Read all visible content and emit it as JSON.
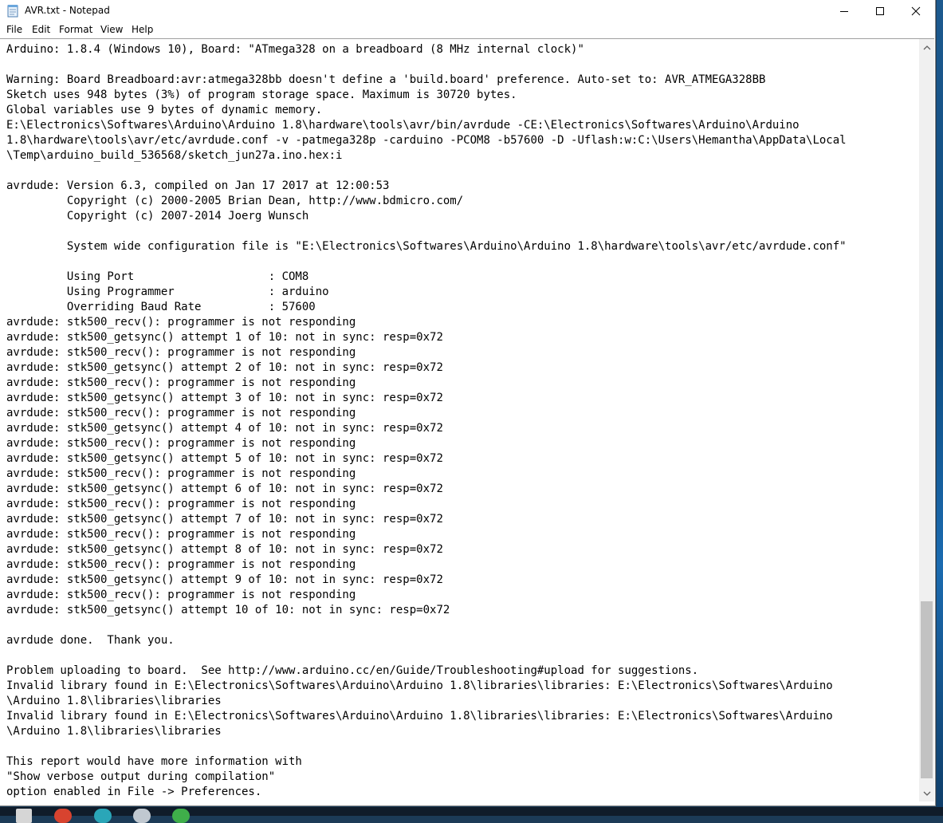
{
  "window": {
    "title": "AVR.txt - Notepad",
    "app_icon": "notepad-icon",
    "controls": {
      "minimize": "minimize-icon",
      "maximize": "maximize-icon",
      "close": "close-icon"
    }
  },
  "menu": {
    "items": [
      {
        "label": "File"
      },
      {
        "label": "Edit"
      },
      {
        "label": "Format"
      },
      {
        "label": "View"
      },
      {
        "label": "Help"
      }
    ]
  },
  "editor": {
    "text": "Arduino: 1.8.4 (Windows 10), Board: \"ATmega328 on a breadboard (8 MHz internal clock)\"\n\nWarning: Board Breadboard:avr:atmega328bb doesn't define a 'build.board' preference. Auto-set to: AVR_ATMEGA328BB\nSketch uses 948 bytes (3%) of program storage space. Maximum is 30720 bytes.\nGlobal variables use 9 bytes of dynamic memory.\nE:\\Electronics\\Softwares\\Arduino\\Arduino 1.8\\hardware\\tools\\avr/bin/avrdude -CE:\\Electronics\\Softwares\\Arduino\\Arduino\n1.8\\hardware\\tools\\avr/etc/avrdude.conf -v -patmega328p -carduino -PCOM8 -b57600 -D -Uflash:w:C:\\Users\\Hemantha\\AppData\\Local\n\\Temp\\arduino_build_536568/sketch_jun27a.ino.hex:i\n\navrdude: Version 6.3, compiled on Jan 17 2017 at 12:00:53\n         Copyright (c) 2000-2005 Brian Dean, http://www.bdmicro.com/\n         Copyright (c) 2007-2014 Joerg Wunsch\n\n         System wide configuration file is \"E:\\Electronics\\Softwares\\Arduino\\Arduino 1.8\\hardware\\tools\\avr/etc/avrdude.conf\"\n\n         Using Port                    : COM8\n         Using Programmer              : arduino\n         Overriding Baud Rate          : 57600\navrdude: stk500_recv(): programmer is not responding\navrdude: stk500_getsync() attempt 1 of 10: not in sync: resp=0x72\navrdude: stk500_recv(): programmer is not responding\navrdude: stk500_getsync() attempt 2 of 10: not in sync: resp=0x72\navrdude: stk500_recv(): programmer is not responding\navrdude: stk500_getsync() attempt 3 of 10: not in sync: resp=0x72\navrdude: stk500_recv(): programmer is not responding\navrdude: stk500_getsync() attempt 4 of 10: not in sync: resp=0x72\navrdude: stk500_recv(): programmer is not responding\navrdude: stk500_getsync() attempt 5 of 10: not in sync: resp=0x72\navrdude: stk500_recv(): programmer is not responding\navrdude: stk500_getsync() attempt 6 of 10: not in sync: resp=0x72\navrdude: stk500_recv(): programmer is not responding\navrdude: stk500_getsync() attempt 7 of 10: not in sync: resp=0x72\navrdude: stk500_recv(): programmer is not responding\navrdude: stk500_getsync() attempt 8 of 10: not in sync: resp=0x72\navrdude: stk500_recv(): programmer is not responding\navrdude: stk500_getsync() attempt 9 of 10: not in sync: resp=0x72\navrdude: stk500_recv(): programmer is not responding\navrdude: stk500_getsync() attempt 10 of 10: not in sync: resp=0x72\n\navrdude done.  Thank you.\n\nProblem uploading to board.  See http://www.arduino.cc/en/Guide/Troubleshooting#upload for suggestions.\nInvalid library found in E:\\Electronics\\Softwares\\Arduino\\Arduino 1.8\\libraries\\libraries: E:\\Electronics\\Softwares\\Arduino\n\\Arduino 1.8\\libraries\\libraries\nInvalid library found in E:\\Electronics\\Softwares\\Arduino\\Arduino 1.8\\libraries\\libraries: E:\\Electronics\\Softwares\\Arduino\n\\Arduino 1.8\\libraries\\libraries\n\nThis report would have more information with\n\"Show verbose output during compilation\"\noption enabled in File -> Preferences."
  },
  "scrollbar": {
    "up_icon": "chevron-up-icon",
    "down_icon": "chevron-down-icon"
  },
  "taskbar": {
    "icons": [
      "start-icon",
      "chrome-icon",
      "edge-icon",
      "app-icon",
      "green-app-icon"
    ]
  },
  "colors": {
    "desktop_accent": "#1b6bb0",
    "window_bg": "#ffffff",
    "scrollbar_bg": "#f0f0f0",
    "scroll_thumb": "#c2c2c2"
  }
}
